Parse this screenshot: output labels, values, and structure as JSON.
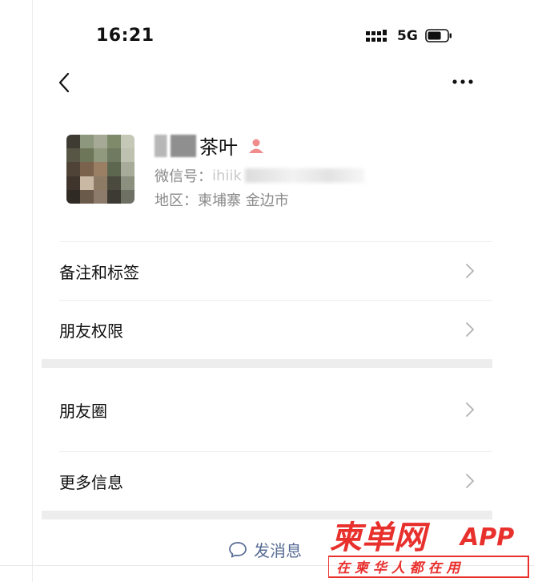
{
  "status_bar": {
    "time": "16:21",
    "network": "5G",
    "battery_level": 0.7
  },
  "nav": {
    "back_icon": "chevron-left-icon",
    "more_icon": "more-dots-icon"
  },
  "profile": {
    "name": "茶叶",
    "gender_icon": "person-icon",
    "gender_color": "#f08c8c",
    "wechat_id_label": "微信号：",
    "wechat_id_partial": "ihiik",
    "region": "地区：柬埔寨 金边市"
  },
  "rows": [
    {
      "label": "备注和标签"
    },
    {
      "label": "朋友权限"
    },
    {
      "label": "朋友圈"
    },
    {
      "label": "更多信息"
    }
  ],
  "action": {
    "send_label": "发消息",
    "send_icon": "chat-bubble-icon",
    "accent": "#576b95"
  },
  "watermark": {
    "brand": "柬单网",
    "suffix": "APP",
    "slogan": "在 柬 华 人 都 在 用",
    "color": "#e8302d"
  }
}
